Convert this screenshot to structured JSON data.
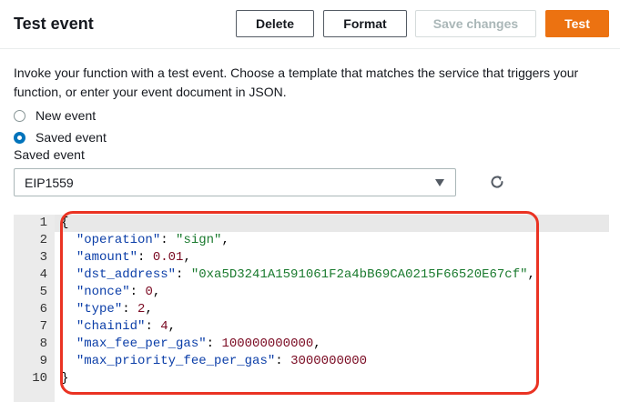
{
  "header": {
    "title": "Test event",
    "buttons": {
      "delete": "Delete",
      "format": "Format",
      "save": "Save changes",
      "test": "Test"
    }
  },
  "description": "Invoke your function with a test event. Choose a template that matches the service that triggers your function, or enter your event document in JSON.",
  "radios": {
    "new_event": "New event",
    "saved_event": "Saved event",
    "selected": "saved_event"
  },
  "saved_event_label": "Saved event",
  "saved_event_select": "EIP1559",
  "editor": {
    "line_numbers": [
      "1",
      "2",
      "3",
      "4",
      "5",
      "6",
      "7",
      "8",
      "9",
      "10"
    ],
    "lines": [
      [
        {
          "t": "punc",
          "v": "{"
        }
      ],
      [
        {
          "t": "punc",
          "v": "  "
        },
        {
          "t": "key",
          "v": "\"operation\""
        },
        {
          "t": "punc",
          "v": ": "
        },
        {
          "t": "str",
          "v": "\"sign\""
        },
        {
          "t": "punc",
          "v": ","
        }
      ],
      [
        {
          "t": "punc",
          "v": "  "
        },
        {
          "t": "key",
          "v": "\"amount\""
        },
        {
          "t": "punc",
          "v": ": "
        },
        {
          "t": "num",
          "v": "0.01"
        },
        {
          "t": "punc",
          "v": ","
        }
      ],
      [
        {
          "t": "punc",
          "v": "  "
        },
        {
          "t": "key",
          "v": "\"dst_address\""
        },
        {
          "t": "punc",
          "v": ": "
        },
        {
          "t": "str",
          "v": "\"0xa5D3241A1591061F2a4bB69CA0215F66520E67cf\""
        },
        {
          "t": "punc",
          "v": ","
        }
      ],
      [
        {
          "t": "punc",
          "v": "  "
        },
        {
          "t": "key",
          "v": "\"nonce\""
        },
        {
          "t": "punc",
          "v": ": "
        },
        {
          "t": "num",
          "v": "0"
        },
        {
          "t": "punc",
          "v": ","
        }
      ],
      [
        {
          "t": "punc",
          "v": "  "
        },
        {
          "t": "key",
          "v": "\"type\""
        },
        {
          "t": "punc",
          "v": ": "
        },
        {
          "t": "num",
          "v": "2"
        },
        {
          "t": "punc",
          "v": ","
        }
      ],
      [
        {
          "t": "punc",
          "v": "  "
        },
        {
          "t": "key",
          "v": "\"chainid\""
        },
        {
          "t": "punc",
          "v": ": "
        },
        {
          "t": "num",
          "v": "4"
        },
        {
          "t": "punc",
          "v": ","
        }
      ],
      [
        {
          "t": "punc",
          "v": "  "
        },
        {
          "t": "key",
          "v": "\"max_fee_per_gas\""
        },
        {
          "t": "punc",
          "v": ": "
        },
        {
          "t": "num",
          "v": "100000000000"
        },
        {
          "t": "punc",
          "v": ","
        }
      ],
      [
        {
          "t": "punc",
          "v": "  "
        },
        {
          "t": "key",
          "v": "\"max_priority_fee_per_gas\""
        },
        {
          "t": "punc",
          "v": ": "
        },
        {
          "t": "num",
          "v": "3000000000"
        }
      ],
      [
        {
          "t": "punc",
          "v": "}"
        }
      ]
    ]
  },
  "icons": {
    "refresh": "refresh-icon",
    "dropdown": "caret-down-icon"
  },
  "colors": {
    "primary": "#ec7211",
    "radio_selected": "#0073bb",
    "annotation": "#ea3323"
  }
}
